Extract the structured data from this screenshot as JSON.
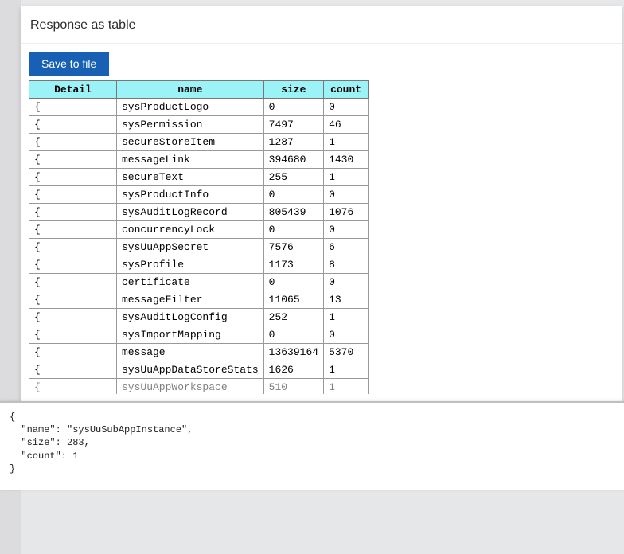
{
  "panel": {
    "title": "Response as table",
    "save_label": "Save to file"
  },
  "table": {
    "headers": [
      "Detail",
      "name",
      "size",
      "count"
    ],
    "rows": [
      {
        "detail": "{",
        "name": "sysProductLogo",
        "size": "0",
        "count": "0"
      },
      {
        "detail": "{",
        "name": "sysPermission",
        "size": "7497",
        "count": "46"
      },
      {
        "detail": "{",
        "name": "secureStoreItem",
        "size": "1287",
        "count": "1"
      },
      {
        "detail": "{",
        "name": "messageLink",
        "size": "394680",
        "count": "1430"
      },
      {
        "detail": "{",
        "name": "secureText",
        "size": "255",
        "count": "1"
      },
      {
        "detail": "{",
        "name": "sysProductInfo",
        "size": "0",
        "count": "0"
      },
      {
        "detail": "{",
        "name": "sysAuditLogRecord",
        "size": "805439",
        "count": "1076"
      },
      {
        "detail": "{",
        "name": "concurrencyLock",
        "size": "0",
        "count": "0"
      },
      {
        "detail": "{",
        "name": "sysUuAppSecret",
        "size": "7576",
        "count": "6"
      },
      {
        "detail": "{",
        "name": "sysProfile",
        "size": "1173",
        "count": "8"
      },
      {
        "detail": "{",
        "name": "certificate",
        "size": "0",
        "count": "0"
      },
      {
        "detail": "{",
        "name": "messageFilter",
        "size": "11065",
        "count": "13"
      },
      {
        "detail": "{",
        "name": "sysAuditLogConfig",
        "size": "252",
        "count": "1"
      },
      {
        "detail": "{",
        "name": "sysImportMapping",
        "size": "0",
        "count": "0"
      },
      {
        "detail": "{",
        "name": "message",
        "size": "13639164",
        "count": "5370"
      },
      {
        "detail": "{",
        "name": "sysUuAppDataStoreStats",
        "size": "1626",
        "count": "1"
      },
      {
        "detail": "{",
        "name": "sysUuAppWorkspace",
        "size": "510",
        "count": "1"
      }
    ]
  },
  "detail_json": {
    "lines": [
      "{",
      "  \"name\": \"sysUuSubAppInstance\",",
      "  \"size\": 283,",
      "  \"count\": 1",
      "}"
    ]
  }
}
